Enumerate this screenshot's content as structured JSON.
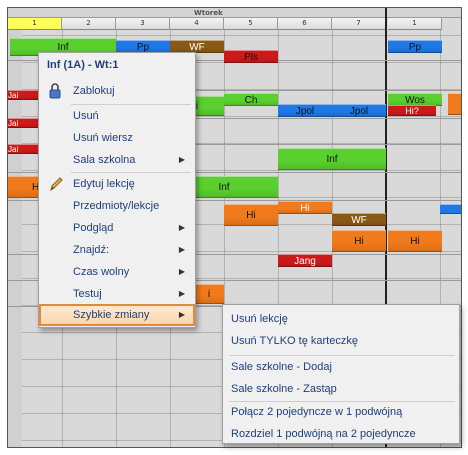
{
  "timetable": {
    "day_label": "Wtorek",
    "columns": [
      "1",
      "2",
      "3",
      "4",
      "5",
      "6",
      "7",
      "1"
    ],
    "lessons": [
      {
        "text": "Inf",
        "color": "#5ad02e"
      },
      {
        "text": "Pp",
        "color": "#1e78e6"
      },
      {
        "text": "WF",
        "color": "#8a5a14"
      },
      {
        "text": "Pls",
        "color": "#cc1a1a"
      },
      {
        "text": "Pp",
        "color": "#1e78e6"
      },
      {
        "text": "Jai",
        "color": "#cc1a1a"
      },
      {
        "text": "Jai",
        "color": "#cc1a1a"
      },
      {
        "text": "Jai",
        "color": "#cc1a1a"
      },
      {
        "text": "H",
        "color": "#f07a1c"
      },
      {
        "text": "i",
        "color": "#5ad02e"
      },
      {
        "text": "Ch",
        "color": "#5ad02e"
      },
      {
        "text": "Jpol",
        "color": "#1e78e6"
      },
      {
        "text": "Jpol",
        "color": "#1e78e6"
      },
      {
        "text": "Wos",
        "color": "#5ad02e"
      },
      {
        "text": "Hi?",
        "color": "#cc1a1a"
      },
      {
        "text": "Inf",
        "color": "#5ad02e"
      },
      {
        "text": "Inf",
        "color": "#5ad02e"
      },
      {
        "text": "Hi",
        "color": "#f07a1c"
      },
      {
        "text": "Hi",
        "color": "#f07a1c"
      },
      {
        "text": "WF",
        "color": "#8a5a14"
      },
      {
        "text": "Hi",
        "color": "#f07a1c"
      },
      {
        "text": "Hi",
        "color": "#f07a1c"
      },
      {
        "text": "Jang",
        "color": "#cc1a1a"
      },
      {
        "text": "i",
        "color": "#f07a1c"
      }
    ]
  },
  "context_menu": {
    "title": "Inf (1A) - Wt:1",
    "items": [
      {
        "label": "Zablokuj",
        "icon": "lock-icon",
        "submenu": false
      },
      {
        "label": "Usuń",
        "submenu": false
      },
      {
        "label": "Usuń wiersz",
        "submenu": false
      },
      {
        "label": "Sala szkolna",
        "submenu": true
      },
      {
        "label": "Edytuj lekcję",
        "icon": "pencil-icon",
        "submenu": false
      },
      {
        "label": "Przedmioty/lekcje",
        "submenu": false
      },
      {
        "label": "Podgląd",
        "submenu": true
      },
      {
        "label": "Znajdź:",
        "submenu": true
      },
      {
        "label": "Czas wolny",
        "submenu": true
      },
      {
        "label": "Testuj",
        "submenu": true
      },
      {
        "label": "Szybkie zmiany",
        "submenu": true,
        "highlighted": true
      }
    ]
  },
  "submenu": {
    "items": [
      "Usuń lekcję",
      "Usuń TYLKO tę karteczkę",
      "Sale szkolne - Dodaj",
      "Sale szkolne - Zastąp",
      "Połącz 2 pojedyncze w 1 podwójną",
      "Rozdziel 1 podwójną na 2 pojedyncze"
    ]
  },
  "colors": {
    "menu_text": "#1e3f78",
    "highlight_border": "#e08a3c",
    "active_column": "#ffff5a"
  }
}
